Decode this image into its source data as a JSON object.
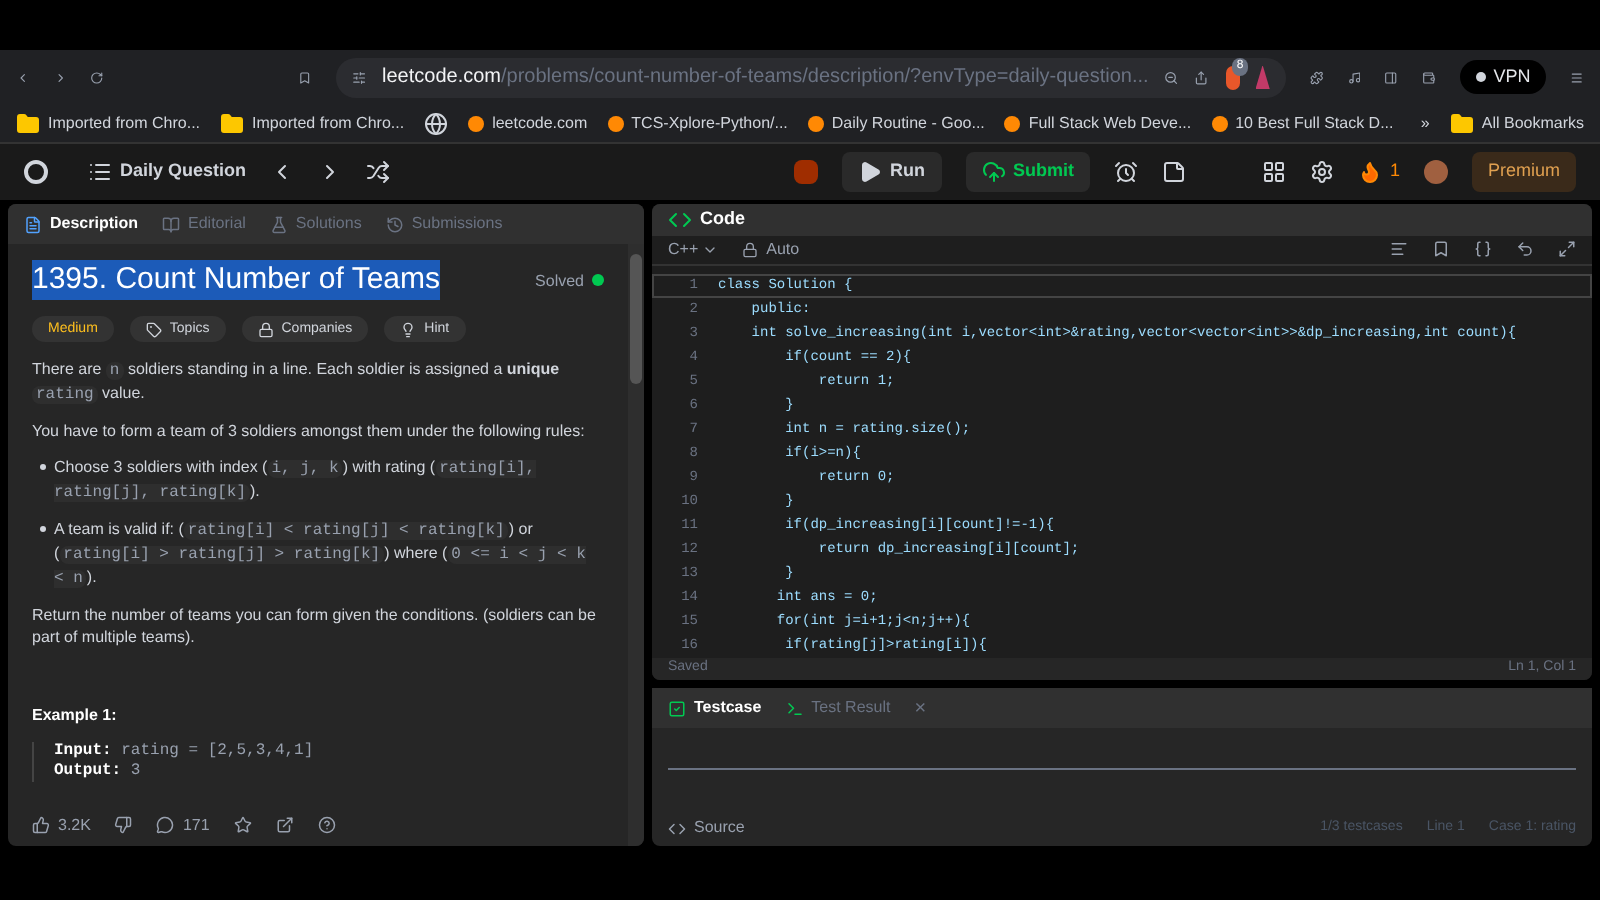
{
  "browser": {
    "url_host": "leetcode.com",
    "url_path": "/problems/count-number-of-teams/description/?envType=daily-question...",
    "vpn": "VPN",
    "shield_badge": "8",
    "bookmarks": [
      {
        "kind": "folder",
        "label": "Imported from Chro..."
      },
      {
        "kind": "folder",
        "label": "Imported from Chro..."
      },
      {
        "kind": "globe"
      },
      {
        "kind": "site",
        "label": "leetcode.com"
      },
      {
        "kind": "site",
        "label": "TCS-Xplore-Python/..."
      },
      {
        "kind": "site",
        "label": "Daily Routine - Goo..."
      },
      {
        "kind": "site",
        "label": "Full Stack Web Deve..."
      },
      {
        "kind": "site",
        "label": "10 Best Full Stack D..."
      }
    ],
    "more": "»",
    "all_bookmarks": "All Bookmarks"
  },
  "header": {
    "daily": "Daily Question",
    "run": "Run",
    "submit": "Submit",
    "streak": "1",
    "premium": "Premium"
  },
  "left": {
    "tabs": [
      {
        "label": "Description",
        "selected": true
      },
      {
        "label": "Editorial",
        "selected": false
      },
      {
        "label": "Solutions",
        "selected": false
      },
      {
        "label": "Submissions",
        "selected": false
      }
    ],
    "title": "1395. Count Number of Teams",
    "title_selected": true,
    "status": "Solved",
    "solved": true,
    "difficulty": "Medium",
    "tags": [
      "Topics",
      "Companies",
      "Hint"
    ],
    "paragraphs": [
      {
        "kind": "p",
        "parts": [
          {
            "kind": "text",
            "text": "There are "
          },
          {
            "kind": "code",
            "text": "n"
          },
          {
            "kind": "rich",
            "text": " soldiers standing in a line. Each soldier is assigned a **unique** "
          },
          {
            "kind": "code",
            "text": "rating"
          },
          {
            "kind": "text",
            "text": " value."
          }
        ]
      },
      {
        "kind": "p",
        "parts": [
          {
            "kind": "text",
            "text": "You have to form a team of 3 soldiers amongst them under the following rules:"
          }
        ]
      },
      {
        "kind": "li",
        "parts": [
          {
            "kind": "text",
            "text": "Choose 3 soldiers with index ("
          },
          {
            "kind": "code",
            "text": "i, j, k"
          },
          {
            "kind": "text",
            "text": ") with rating ("
          },
          {
            "kind": "code",
            "text": "rating[i], rating[j], rating[k]"
          },
          {
            "kind": "text",
            "text": ")."
          }
        ]
      },
      {
        "kind": "li",
        "parts": [
          {
            "kind": "text",
            "text": "A team is valid if: ("
          },
          {
            "kind": "code",
            "text": "rating[i] < rating[j] < rating[k]"
          },
          {
            "kind": "text",
            "text": ") or ("
          },
          {
            "kind": "code",
            "text": "rating[i] > rating[j] > rating[k]"
          },
          {
            "kind": "text",
            "text": ") where ("
          },
          {
            "kind": "code",
            "text": "0 <= i < j < k < n"
          },
          {
            "kind": "text",
            "text": ")."
          }
        ]
      },
      {
        "kind": "p",
        "parts": [
          {
            "kind": "text",
            "text": "Return the number of teams you can form given the conditions. (soldiers can be part of multiple teams)."
          }
        ]
      }
    ],
    "example_title": "Example 1:",
    "example": [
      {
        "label": "Input:",
        "value": "rating = [2,5,3,4,1]"
      },
      {
        "label": "Output:",
        "value": "3"
      }
    ],
    "likes": "3.2K",
    "comments": "171"
  },
  "code": {
    "title": "Code",
    "language": "C++",
    "mode": "Auto",
    "lines": [
      {
        "n": "1",
        "text": "class Solution {"
      },
      {
        "n": "2",
        "text": "    public:"
      },
      {
        "n": "3",
        "text": "    int solve_increasing(int i,vector<int>&rating,vector<vector<int>>&dp_increasing,int count){"
      },
      {
        "n": "4",
        "text": "        if(count == 2){"
      },
      {
        "n": "5",
        "text": "            return 1;"
      },
      {
        "n": "6",
        "text": "        }"
      },
      {
        "n": "7",
        "text": "        int n = rating.size();"
      },
      {
        "n": "8",
        "text": "        if(i>=n){"
      },
      {
        "n": "9",
        "text": "            return 0;"
      },
      {
        "n": "10",
        "text": "        }"
      },
      {
        "n": "11",
        "text": "        if(dp_increasing[i][count]!=-1){"
      },
      {
        "n": "12",
        "text": "            return dp_increasing[i][count];"
      },
      {
        "n": "13",
        "text": "        }"
      },
      {
        "n": "14",
        "text": "       int ans = 0;"
      },
      {
        "n": "15",
        "text": "       for(int j=i+1;j<n;j++){"
      },
      {
        "n": "16",
        "text": "        if(rating[j]>rating[i]){"
      }
    ],
    "saved": "Saved",
    "position": "Ln 1, Col 1"
  },
  "console": {
    "tabs": [
      {
        "label": "Testcase",
        "selected": true
      },
      {
        "label": "Test Result",
        "selected": false
      }
    ],
    "close": "×",
    "source": "Source",
    "status": [
      "1/3 testcases",
      "Line 1",
      "Case 1: rating"
    ]
  }
}
